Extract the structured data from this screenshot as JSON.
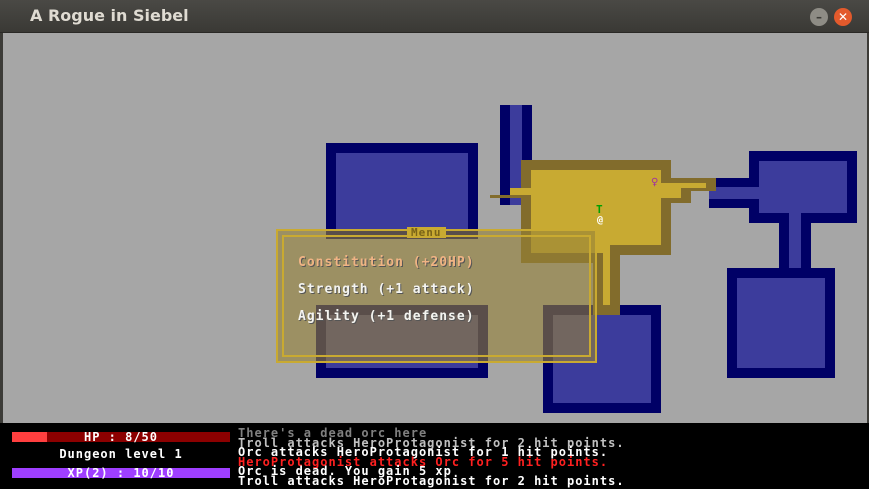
{
  "window": {
    "title": "A Rogue in Siebel",
    "min_icon": "minimize-icon",
    "close_icon": "close-icon"
  },
  "map": {
    "floor_color": "#3c3c9c",
    "wall_color": "#000066",
    "lit_floor_color": "#c8aa32",
    "lit_wall_color": "#826c2c",
    "entities": [
      {
        "glyph": "T",
        "name": "troll",
        "color": "#00a000"
      },
      {
        "glyph": "@",
        "name": "player",
        "color": "#ffffff"
      },
      {
        "glyph": "♀",
        "name": "item",
        "color": "#a030a0"
      }
    ]
  },
  "menu": {
    "title": "Menu",
    "options": [
      {
        "label": "Constitution (+20HP)",
        "selected": true
      },
      {
        "label": "Strength (+1 attack)",
        "selected": false
      },
      {
        "label": "Agility (+1 defense)",
        "selected": false
      }
    ]
  },
  "hud": {
    "hp": {
      "label": "HP : 8/50",
      "fraction": 0.16,
      "fill_color": "#ff3f3f",
      "bg_color": "#8c0000"
    },
    "dungeon_level": "Dungeon level 1",
    "xp": {
      "label": "XP(2) : 10/10",
      "fraction": 1.0,
      "fill_color": "#9f3fff",
      "bg_color": "#3c1464"
    }
  },
  "log": [
    {
      "text": "There's a dead orc here",
      "color": "#808080"
    },
    {
      "text": "Troll attacks HeroProtagonist for 2 hit points.",
      "color": "#c0c0c0"
    },
    {
      "text": "Orc attacks HeroProtagonist for 1 hit points.",
      "color": "#ffffff"
    },
    {
      "text": "HeroProtagonist attacks Orc for 5 hit points.",
      "color": "#ff2020"
    },
    {
      "text": "Orc is dead. You gain 5 xp",
      "color": "#ffffff"
    },
    {
      "text": "Troll attacks HeroProtagonist for 2 hit points.",
      "color": "#ffffff"
    }
  ]
}
